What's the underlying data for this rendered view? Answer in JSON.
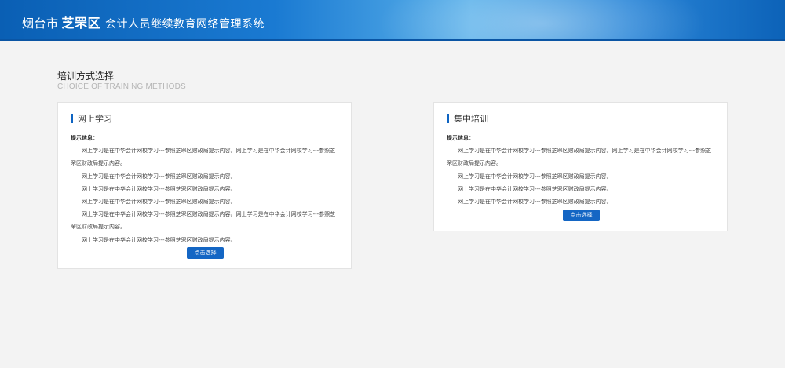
{
  "header": {
    "city": "烟台市",
    "district": "芝罘区",
    "system_name": "会计人员继续教育网络管理系统"
  },
  "section": {
    "title": "培训方式选择",
    "subtitle": "CHOICE OF TRAINING METHODS"
  },
  "colors": {
    "accent": "#0e64c2",
    "button": "#1466c4",
    "header_start": "#0a5fb4",
    "header_end": "#0c62b8"
  },
  "cards": [
    {
      "title": "网上学习",
      "tip_label": "提示信息：",
      "paragraphs": [
        "网上学习是在中华会计网校学习---参照芝罘区财政局提示内容。网上学习是在中华会计网校学习---参照芝罘区财政局提示内容。",
        "网上学习是在中华会计网校学习---参照芝罘区财政局提示内容。",
        "网上学习是在中华会计网校学习---参照芝罘区财政局提示内容。",
        "网上学习是在中华会计网校学习---参照芝罘区财政局提示内容。",
        "网上学习是在中华会计网校学习---参照芝罘区财政局提示内容。网上学习是在中华会计网校学习---参照芝罘区财政局提示内容。",
        "网上学习是在中华会计网校学习---参照芝罘区财政局提示内容。"
      ],
      "button_label": "点击选择"
    },
    {
      "title": "集中培训",
      "tip_label": "提示信息：",
      "paragraphs": [
        "网上学习是在中华会计网校学习---参照芝罘区财政局提示内容。网上学习是在中华会计网校学习---参照芝罘区财政局提示内容。",
        "网上学习是在中华会计网校学习---参照芝罘区财政局提示内容。",
        "网上学习是在中华会计网校学习---参照芝罘区财政局提示内容。",
        "网上学习是在中华会计网校学习---参照芝罘区财政局提示内容。"
      ],
      "button_label": "点击选择"
    }
  ]
}
